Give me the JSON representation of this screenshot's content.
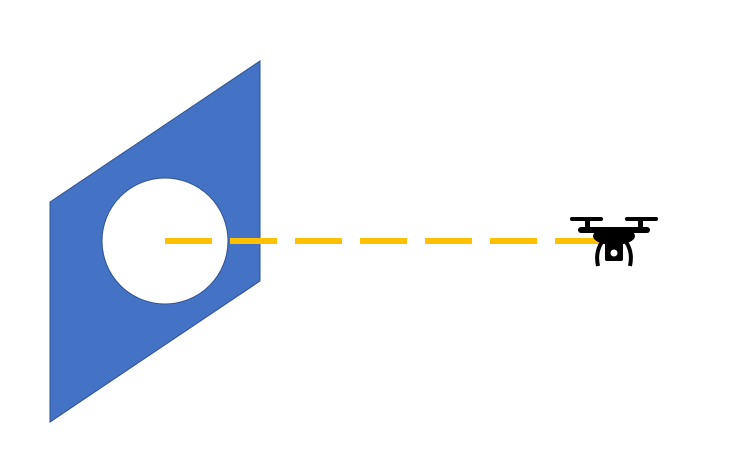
{
  "colors": {
    "background": "#ffffff",
    "panel_fill": "#4472c4",
    "panel_stroke": "#2f528f",
    "hole_fill": "#ffffff",
    "path_line": "#ffc000",
    "drone": "#000000"
  },
  "icons": {
    "drone": "drone-icon"
  },
  "elements": {
    "panel": "wall-panel-with-circular-opening",
    "path": "dashed-flight-path"
  }
}
